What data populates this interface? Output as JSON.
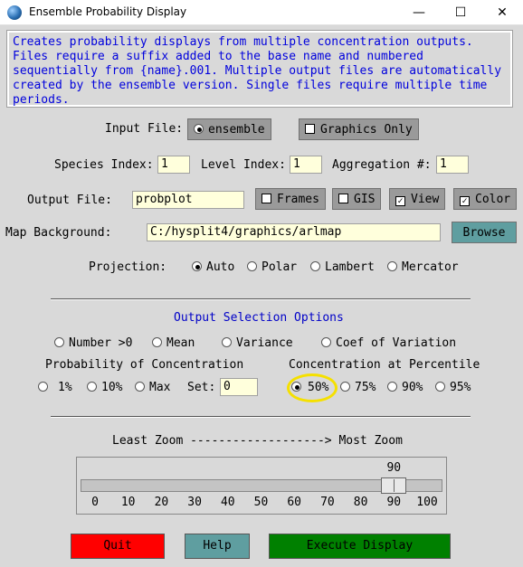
{
  "window": {
    "title": "Ensemble Probability Display",
    "minimize": "—",
    "maximize": "☐",
    "close": "✕"
  },
  "description": "Creates probability displays from multiple concentration outputs.\nFiles require a suffix added to the base name and numbered\nsequentially from {name}.001. Multiple output files are automatically\ncreated by the ensemble version. Single files require multiple time\nperiods.",
  "input": {
    "label": "Input File:",
    "ensemble": "ensemble",
    "graphics_only": "Graphics Only"
  },
  "indices": {
    "species_label": "Species Index:",
    "species_value": "1",
    "level_label": "Level Index:",
    "level_value": "1",
    "aggregation_label": "Aggregation #:",
    "aggregation_value": "1"
  },
  "output": {
    "label": "Output File:",
    "value": "probplot",
    "frames": "Frames",
    "gis": "GIS",
    "view": "View",
    "color": "Color"
  },
  "map": {
    "label": "Map Background:",
    "value": "C:/hysplit4/graphics/arlmap",
    "browse": "Browse"
  },
  "projection": {
    "label": "Projection:",
    "auto": "Auto",
    "polar": "Polar",
    "lambert": "Lambert",
    "mercator": "Mercator"
  },
  "options": {
    "title": "Output Selection Options",
    "number": "Number >0",
    "mean": "Mean",
    "variance": "Variance",
    "coef": "Coef of Variation",
    "prob_title": "Probability of Concentration",
    "p1": "1%",
    "p10": "10%",
    "pmax": "Max",
    "set_label": "Set:",
    "set_value": "0",
    "perc_title": "Concentration at Percentile",
    "c50": "50%",
    "c75": "75%",
    "c90": "90%",
    "c95": "95%"
  },
  "zoom": {
    "label": "Least Zoom -------------------> Most Zoom",
    "value": "90",
    "ticks": [
      "0",
      "10",
      "20",
      "30",
      "40",
      "50",
      "60",
      "70",
      "80",
      "90",
      "100"
    ]
  },
  "buttons": {
    "quit": "Quit",
    "help": "Help",
    "execute": "Execute Display"
  },
  "colors": {
    "description_text": "#0000dd",
    "quit": "#ff0000",
    "help": "#5f9ea0",
    "execute": "#008000",
    "entry_bg": "#ffffdc",
    "highlight": "#f5e000"
  }
}
